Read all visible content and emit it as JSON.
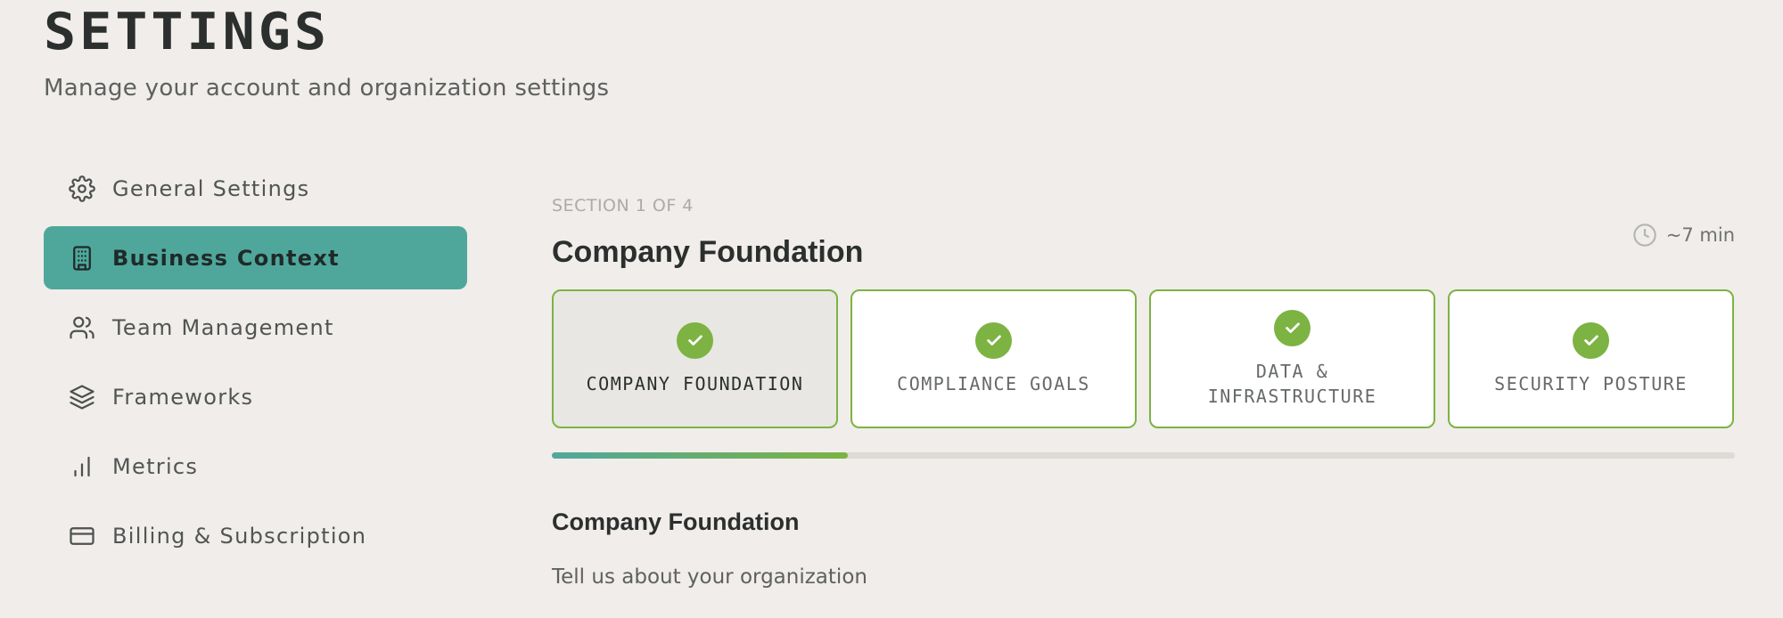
{
  "header": {
    "title": "SETTINGS",
    "subtitle": "Manage your account and organization settings"
  },
  "sidebar": {
    "items": [
      {
        "label": "General Settings",
        "icon": "gear-icon",
        "active": false
      },
      {
        "label": "Business Context",
        "icon": "building-icon",
        "active": true
      },
      {
        "label": "Team Management",
        "icon": "users-icon",
        "active": false
      },
      {
        "label": "Frameworks",
        "icon": "layers-icon",
        "active": false
      },
      {
        "label": "Metrics",
        "icon": "bar-chart-icon",
        "active": false
      },
      {
        "label": "Billing & Subscription",
        "icon": "credit-card-icon",
        "active": false
      }
    ]
  },
  "main": {
    "section_label": "SECTION 1 OF 4",
    "section_title": "Company Foundation",
    "duration": "~7 min",
    "steps": [
      {
        "label": "COMPANY FOUNDATION",
        "completed": true,
        "current": true
      },
      {
        "label": "COMPLIANCE GOALS",
        "completed": true,
        "current": false
      },
      {
        "label": "DATA & INFRASTRUCTURE",
        "completed": true,
        "current": false
      },
      {
        "label": "SECURITY POSTURE",
        "completed": true,
        "current": false
      }
    ],
    "progress": 0.25,
    "content_title": "Company Foundation",
    "content_description": "Tell us about your organization"
  },
  "colors": {
    "accent": "#4fa79c",
    "success": "#7cb342",
    "background": "#f0edea"
  }
}
